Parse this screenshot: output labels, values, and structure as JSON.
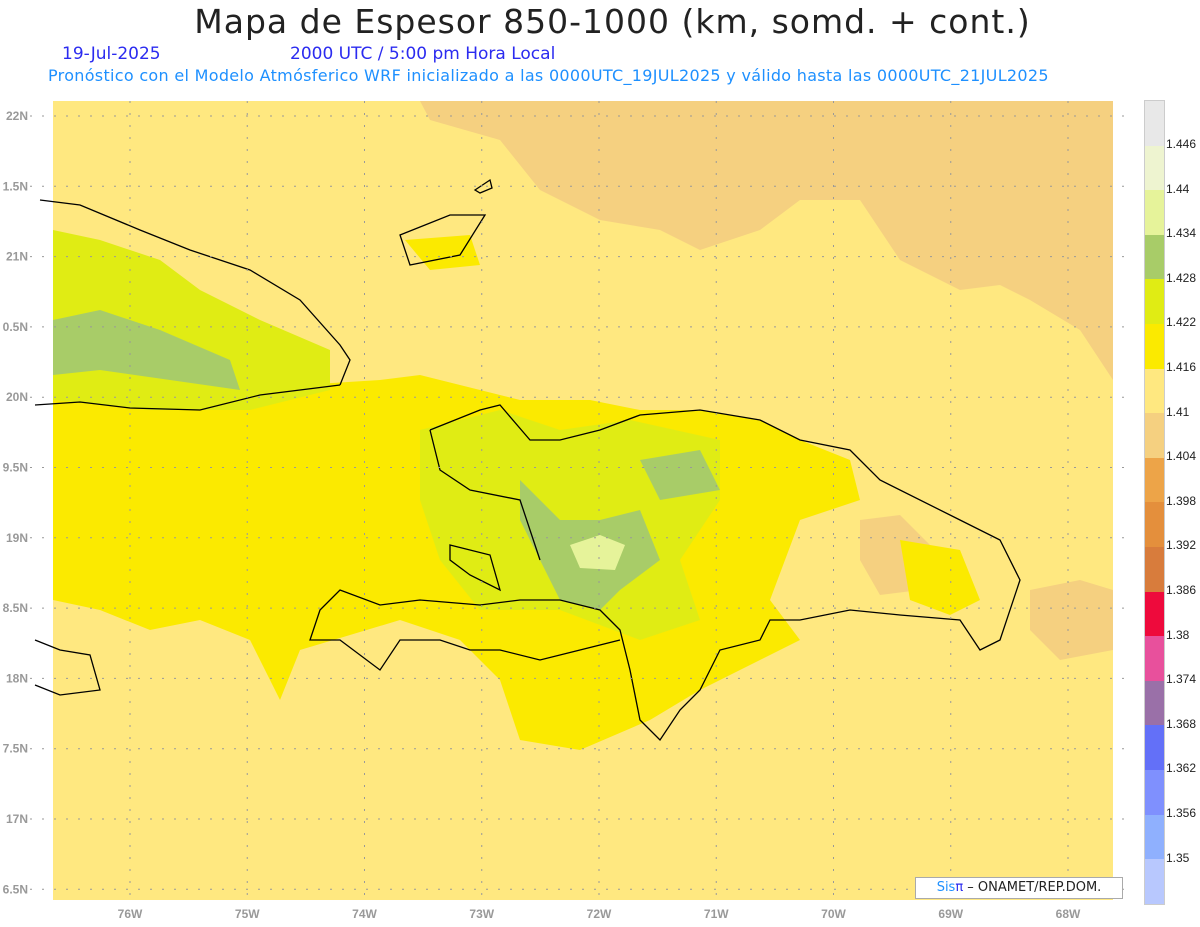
{
  "title": "Mapa de Espesor 850-1000 (km, somd. + cont.)",
  "date": "19-Jul-2025",
  "time": "2000 UTC / 5:00 pm Hora Local",
  "subtitle": "Pronóstico con el Modelo Atmósferico WRF inicializado a las 0000UTC_19JUL2025 y válido hasta las  0000UTC_21JUL2025",
  "lat_labels": [
    "22N",
    "1.5N",
    "21N",
    "0.5N",
    "20N",
    "9.5N",
    "19N",
    "8.5N",
    "18N",
    "7.5N",
    "17N",
    "6.5N"
  ],
  "lon_labels": [
    "76W",
    "75W",
    "74W",
    "73W",
    "72W",
    "71W",
    "70W",
    "69W",
    "68W"
  ],
  "colorbar": {
    "labels": [
      "1.446",
      "1.44",
      "1.434",
      "1.428",
      "1.422",
      "1.416",
      "1.41",
      "1.404",
      "1.398",
      "1.392",
      "1.386",
      "1.38",
      "1.374",
      "1.368",
      "1.362",
      "1.356",
      "1.35"
    ],
    "colors": [
      "#e8e8e8",
      "#eef4d0",
      "#e6f39a",
      "#a8cc68",
      "#e0ec14",
      "#fbea00",
      "#ffe880",
      "#f5d080",
      "#eda448",
      "#e48f3c",
      "#d87c3c",
      "#ee0a3c",
      "#e8509c",
      "#9a70a8",
      "#6370f8",
      "#7f90fe",
      "#8fb0fe",
      "#b8c8fe"
    ]
  },
  "credit": {
    "sis": "Sis",
    "pi": "π",
    "rest": " – ONAMET/REP.DOM."
  }
}
